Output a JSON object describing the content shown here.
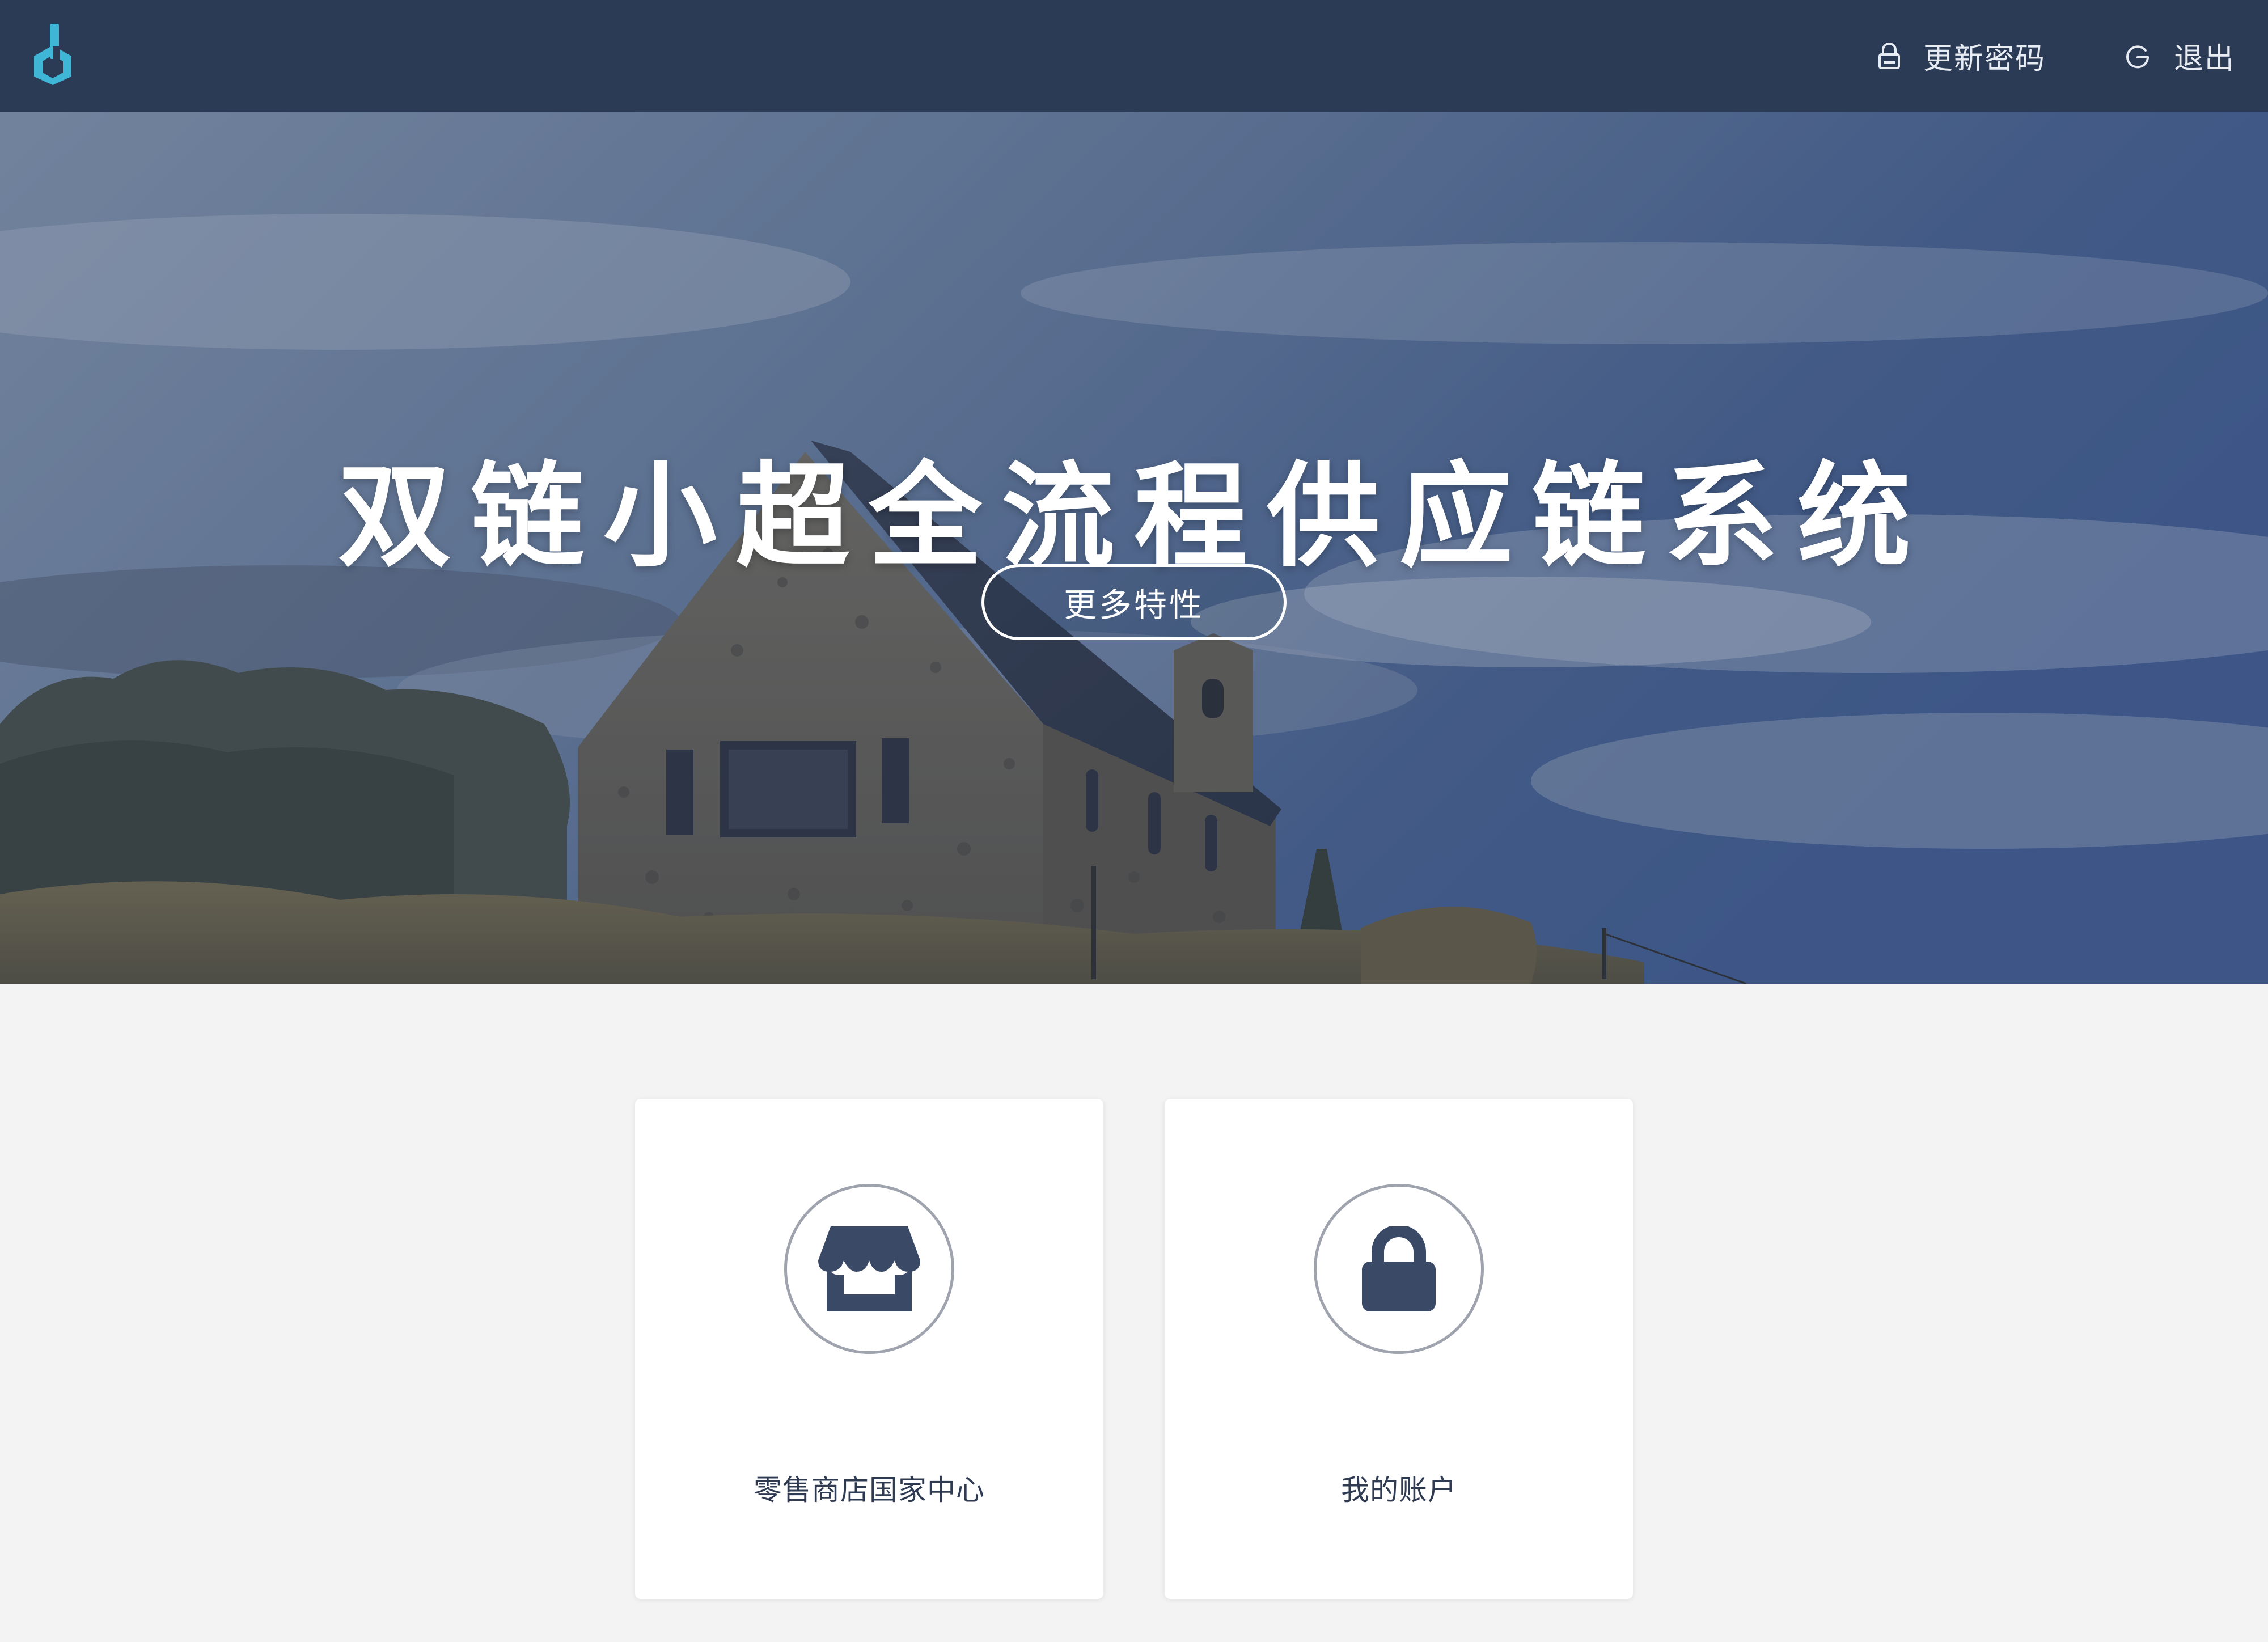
{
  "header": {
    "logo_icon": "hexagon-logo-icon",
    "change_password_label": "更新密码",
    "change_password_icon": "lock-icon",
    "logout_label": "退出",
    "logout_icon": "refresh-logout-icon",
    "bg_color": "#2b3a55",
    "logo_color": "#3fb6d6"
  },
  "hero": {
    "title": "双链小超全流程供应链系统",
    "button_label": "更多特性",
    "background": "stone-church-landscape-image"
  },
  "cards": [
    {
      "icon": "storefront-icon",
      "label": "零售商店国家中心"
    },
    {
      "icon": "padlock-icon",
      "label": "我的账户"
    }
  ]
}
